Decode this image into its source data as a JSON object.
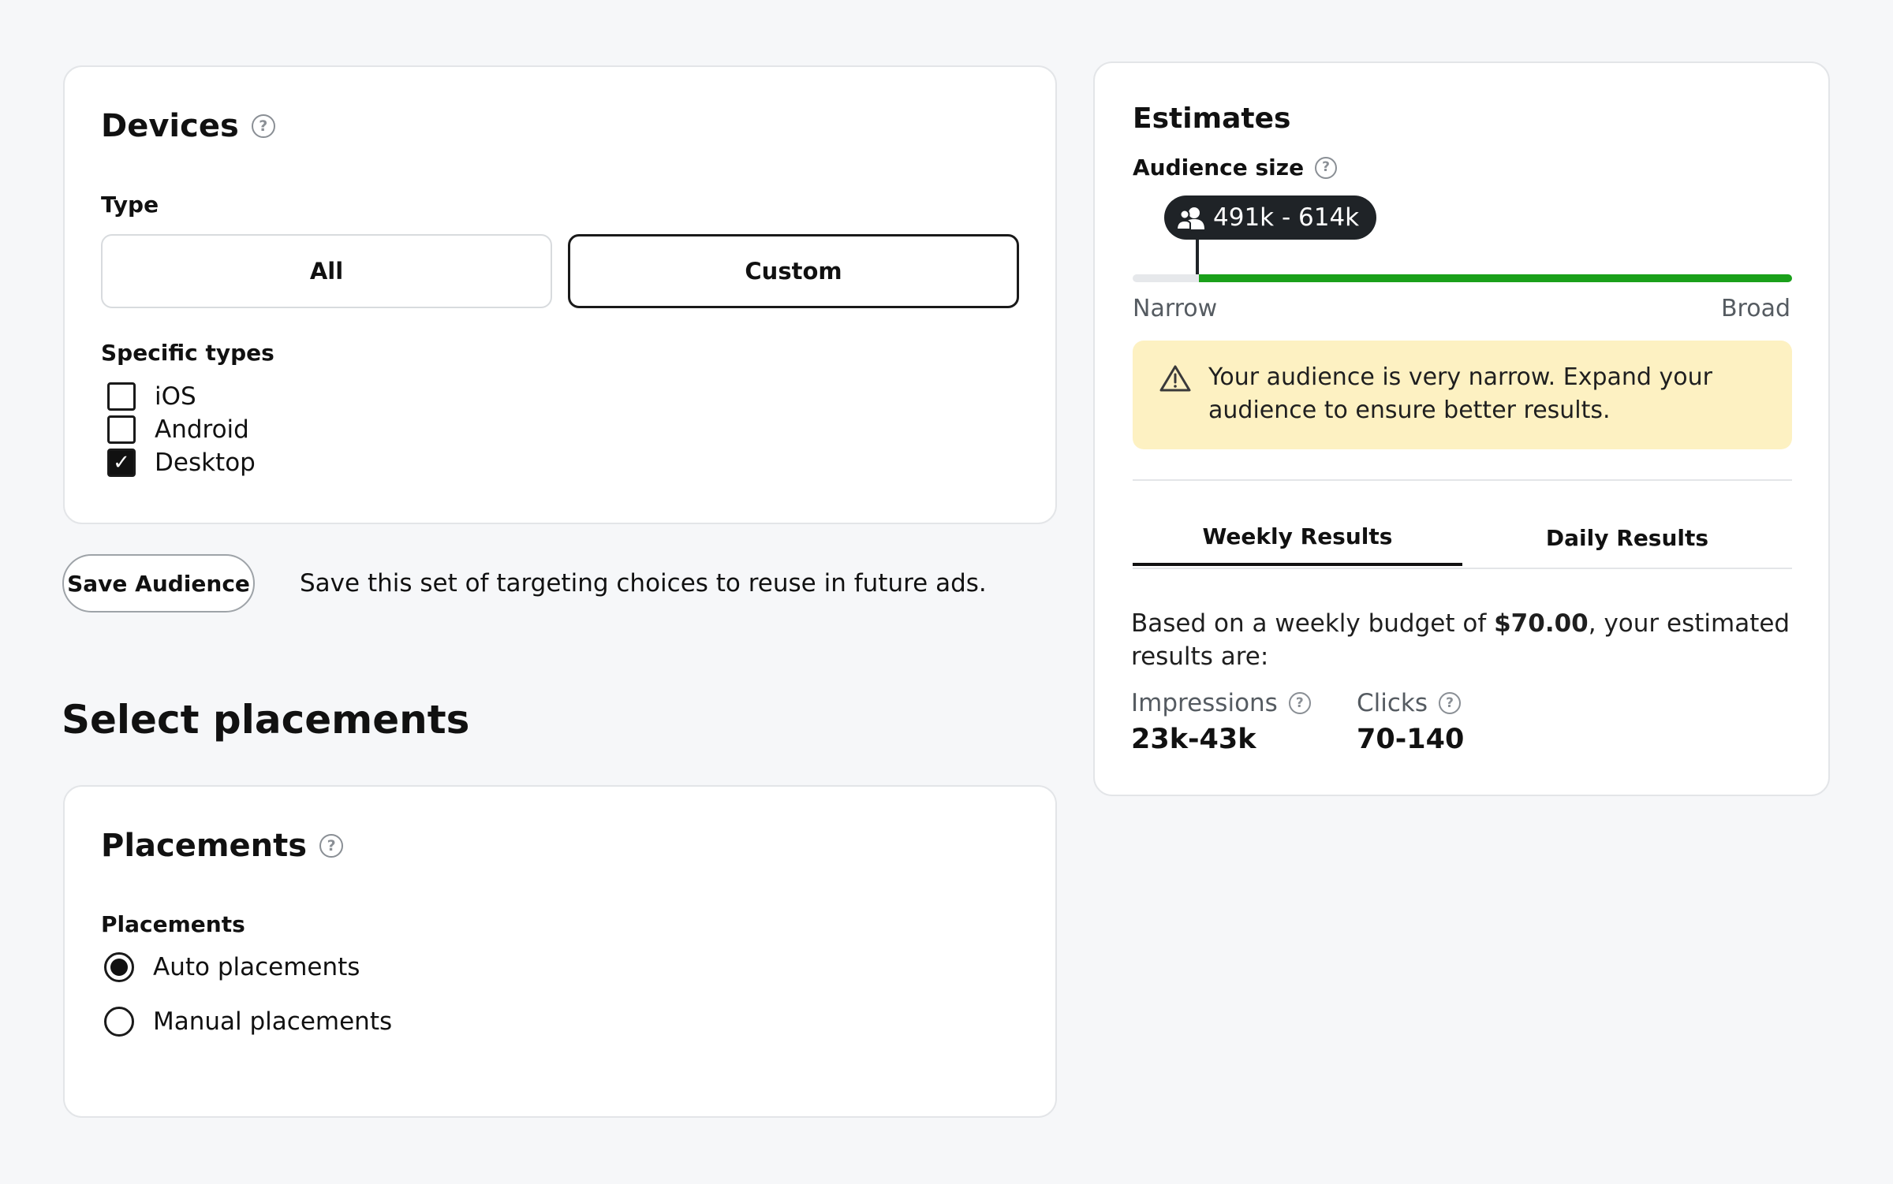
{
  "devices": {
    "title": "Devices",
    "type_label": "Type",
    "type_options": [
      {
        "label": "All",
        "selected": false
      },
      {
        "label": "Custom",
        "selected": true
      }
    ],
    "specific_label": "Specific types",
    "specific_types": [
      {
        "label": "iOS",
        "checked": false
      },
      {
        "label": "Android",
        "checked": false
      },
      {
        "label": "Desktop",
        "checked": true
      }
    ]
  },
  "save_audience": {
    "button_label": "Save Audience",
    "description": "Save this set of targeting choices to reuse in future ads."
  },
  "placements_section": {
    "heading": "Select placements",
    "card_title": "Placements",
    "group_label": "Placements",
    "options": [
      {
        "label": "Auto placements",
        "selected": true
      },
      {
        "label": "Manual placements",
        "selected": false
      }
    ]
  },
  "estimates": {
    "title": "Estimates",
    "audience_size_label": "Audience size",
    "audience_range": "491k - 614k",
    "meter": {
      "level": 0.1,
      "min_label": "Narrow",
      "max_label": "Broad"
    },
    "warning": {
      "line1": "Your audience is very narrow. Expand your",
      "line2": "audience to ensure better results."
    },
    "tabs": [
      {
        "label": "Weekly Results",
        "active": true
      },
      {
        "label": "Daily Results",
        "active": false
      }
    ],
    "budget_prefix": "Based on a weekly budget of ",
    "budget_amount": "$70.00",
    "budget_suffix": ", your estimated",
    "budget_line2": "results are:",
    "metrics": [
      {
        "label": "Impressions",
        "value": "23k-43k"
      },
      {
        "label": "Clicks",
        "value": "70-140"
      }
    ]
  },
  "colors": {
    "meter_fill": "#1aa01a",
    "warning_bg": "#fdf1c2",
    "page_bg": "#f6f7f9"
  },
  "icons": {
    "help": "question-circle-icon",
    "warning": "warning-triangle-icon",
    "audience": "users-icon",
    "check": "checkmark-icon"
  }
}
